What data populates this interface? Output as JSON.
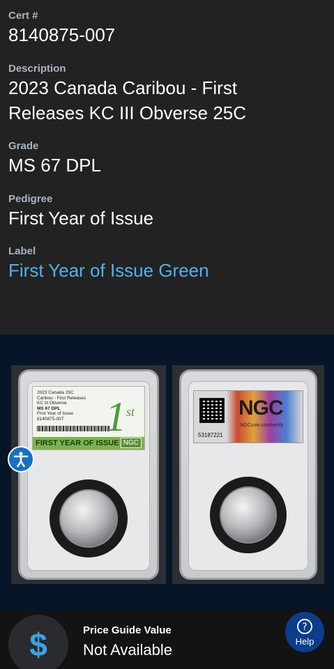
{
  "details": {
    "cert": {
      "label": "Cert #",
      "value": "8140875-007"
    },
    "description": {
      "label": "Description",
      "value_line1": "2023 Canada Caribou - First",
      "value_line2": "Releases KC III Obverse 25C"
    },
    "grade": {
      "label": "Grade",
      "value": "MS 67 DPL"
    },
    "pedigree": {
      "label": "Pedigree",
      "value": "First Year of Issue"
    },
    "label_field": {
      "label": "Label",
      "value": "First Year of Issue Green"
    }
  },
  "front_slab": {
    "label_lines": [
      "2023 Canada 25C",
      "Caribou - First Releases",
      "KC III Obverse",
      "MS 67 DPL",
      "First Year of Issue",
      "8140875-007"
    ],
    "first_text": "1",
    "first_sup": "st",
    "banner": "FIRST YEAR OF ISSUE",
    "ngc": "NGC"
  },
  "back_slab": {
    "ngc": "NGC",
    "site": "NGCcoin.com/verify",
    "cert": "53187221"
  },
  "price_guide": {
    "icon": "$",
    "label": "Price Guide Value",
    "value": "Not Available"
  },
  "help": {
    "label": "Help",
    "icon": "?"
  },
  "colors": {
    "accent": "#4fb3ec",
    "help_bg": "#0a3e8a",
    "access_bg": "#1470c8"
  }
}
